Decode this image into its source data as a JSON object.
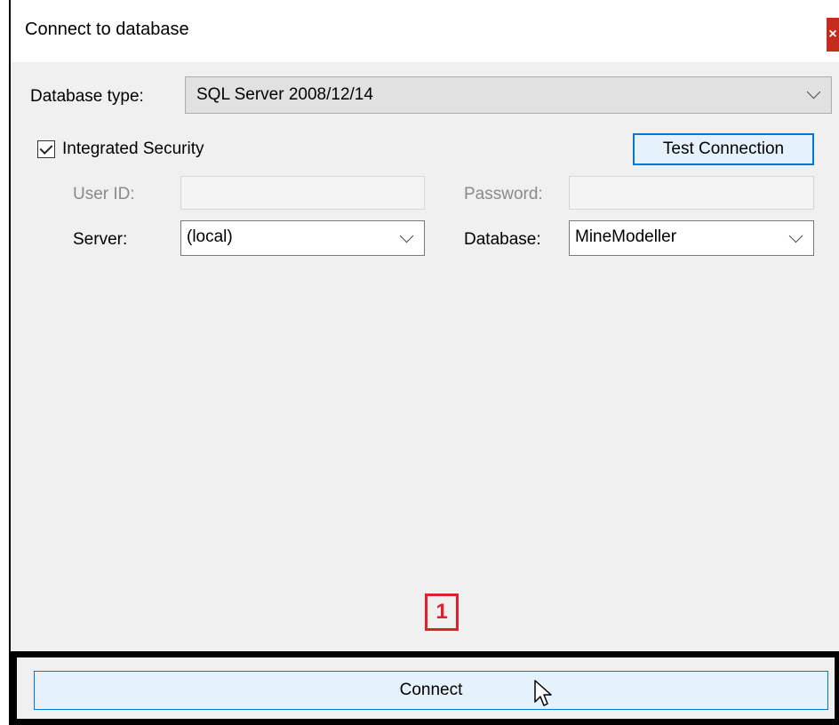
{
  "window": {
    "title": "Connect to database",
    "close_glyph": "×"
  },
  "database_type": {
    "label": "Database type:",
    "value": "SQL Server 2008/12/14"
  },
  "integrated_security": {
    "label": "Integrated Security",
    "checked": true
  },
  "test_connection": {
    "label": "Test Connection"
  },
  "credentials": {
    "user_id_label": "User ID:",
    "user_id_value": "",
    "password_label": "Password:",
    "password_value": ""
  },
  "server": {
    "label": "Server:",
    "value": "(local)"
  },
  "database": {
    "label": "Database:",
    "value": "MineModeller"
  },
  "annotation": {
    "step_number": "1"
  },
  "footer": {
    "connect_label": "Connect"
  },
  "colors": {
    "accent": "#0078d7",
    "close": "#c42b1c",
    "annotation": "#e0202a"
  },
  "icons": {
    "dropdown": "chevron-down-icon",
    "cursor": "mouse-pointer-icon",
    "check": "check-icon"
  }
}
